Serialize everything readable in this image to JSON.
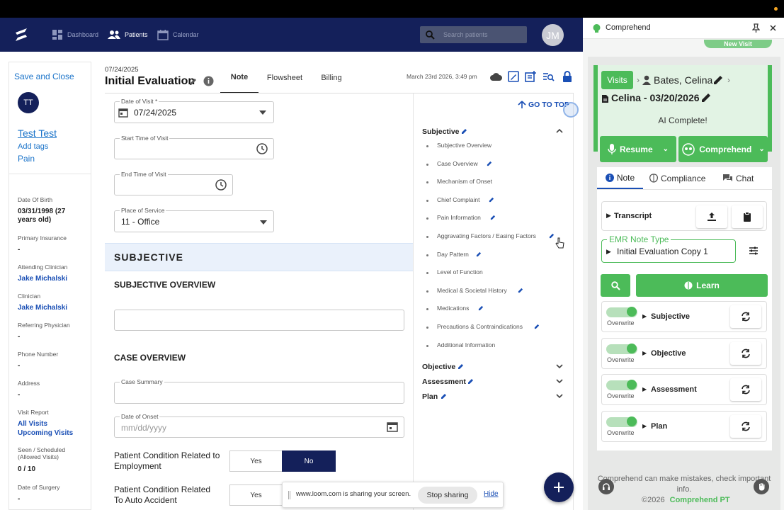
{
  "nav": {
    "dashboard": "Dashboard",
    "patients": "Patients",
    "calendar": "Calendar",
    "search_placeholder": "Search patients",
    "user_initials": "JM"
  },
  "left": {
    "save_close": "Save and Close",
    "initials": "TT",
    "patient_name": "Test Test",
    "add_tags": "Add tags",
    "pain_tag": "Pain",
    "dob_label": "Date Of Birth",
    "dob_value": "03/31/1998 (27 years old)",
    "insurance_label": "Primary Insurance",
    "insurance_value": "-",
    "attending_label": "Attending Clinician",
    "attending_value": "Jake Michalski",
    "clinician_label": "Clinician",
    "clinician_value": "Jake Michalski",
    "referring_label": "Referring Physician",
    "referring_value": "-",
    "phone_label": "Phone Number",
    "phone_value": "-",
    "address_label": "Address",
    "address_value": "-",
    "visit_report_label": "Visit Report",
    "all_visits": "All Visits",
    "upcoming_visits": "Upcoming Visits",
    "seen_label": "Seen / Scheduled (Allowed Visits)",
    "seen_value": "0 / 10",
    "surgery_label": "Date of Surgery",
    "surgery_value": "-"
  },
  "header": {
    "date": "07/24/2025",
    "title": "Initial Evaluation",
    "tabs": [
      "Note",
      "Flowsheet",
      "Billing"
    ],
    "timestamp": "March 23rd 2026, 3:49 pm"
  },
  "form": {
    "date_of_visit_label": "Date of Visit *",
    "date_of_visit_value": "07/24/2025",
    "start_time_label": "Start Time of Visit",
    "end_time_label": "End Time of Visit",
    "place_label": "Place of Service",
    "place_value": "11 - Office",
    "subjective_title": "SUBJECTIVE",
    "subjective_overview": "SUBJECTIVE OVERVIEW",
    "case_overview": "CASE OVERVIEW",
    "case_summary_label": "Case Summary",
    "date_onset_label": "Date of Onset",
    "date_onset_placeholder": "mm/dd/yyyy",
    "employment_label": "Patient Condition Related to Employment",
    "auto_label": "Patient Condition Related To Auto Accident",
    "yes": "Yes",
    "no": "No"
  },
  "outline": {
    "go_to_top": "GO TO TOP",
    "subjective": "Subjective",
    "items": [
      "Subjective Overview",
      "Case Overview",
      "Mechanism of Onset",
      "Chief Complaint",
      "Pain Information",
      "Aggravating Factors / Easing Factors",
      "Day Pattern",
      "Level of Function",
      "Medical & Societal History",
      "Medications",
      "Precautions & Contraindications",
      "Additional Information"
    ],
    "objective": "Objective",
    "assessment": "Assessment",
    "plan": "Plan"
  },
  "share": {
    "message": "www.loom.com is sharing your screen.",
    "stop": "Stop sharing",
    "hide": "Hide"
  },
  "comprehend": {
    "app_title": "Comprehend",
    "new_visit": "New Visit",
    "visits": "Visits",
    "patient": "Bates, Celina",
    "visit_title": "Celina - 03/20/2026",
    "status": "AI Complete!",
    "resume": "Resume",
    "comprehend_btn": "Comprehend",
    "tabs": [
      "Note",
      "Compliance",
      "Chat"
    ],
    "transcript": "Transcript",
    "emr_label": "EMR Note Type",
    "emr_value": "Initial Evaluation Copy 1",
    "learn": "Learn",
    "overwrite": "Overwrite",
    "sections": [
      "Subjective",
      "Objective",
      "Assessment",
      "Plan"
    ],
    "disclaimer": "Comprehend can make mistakes, check important info.",
    "copyright": "©2026",
    "brand": "Comprehend PT",
    "accent": "#4cbb59"
  }
}
